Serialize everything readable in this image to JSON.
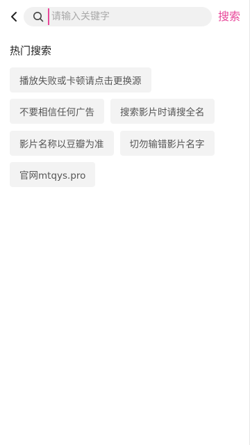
{
  "header": {
    "search_placeholder": "请输入关键字",
    "search_button": "搜索"
  },
  "hot_search": {
    "title": "热门搜索",
    "tags": [
      "播放失败或卡顿请点击更换源",
      "不要相信任何广告",
      "搜索影片时请搜全名",
      "影片名称以豆瓣为准",
      "切勿输错影片名字",
      "官网mtqys.pro"
    ]
  },
  "colors": {
    "accent": "#e8479a",
    "tag_background": "#f3f3f3",
    "search_background": "#f1f1f1"
  },
  "icons": {
    "back": "chevron-left-icon",
    "search": "search-icon"
  }
}
